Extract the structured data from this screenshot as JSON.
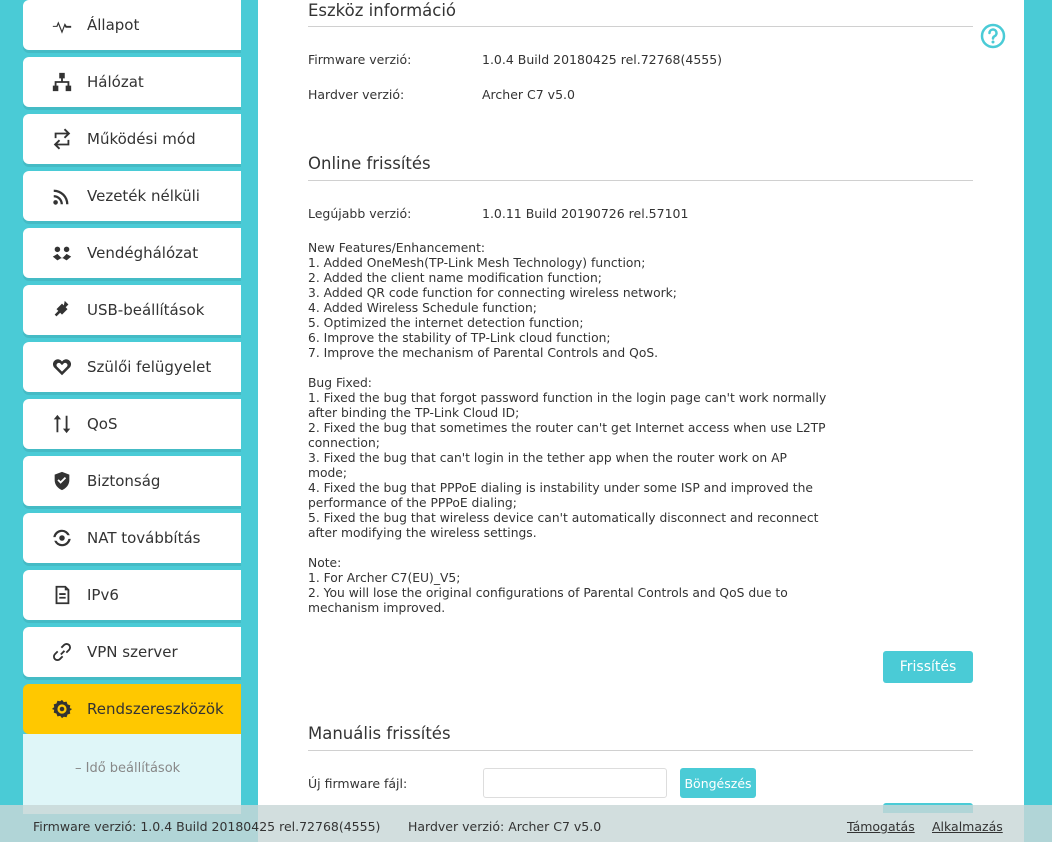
{
  "sidebar": {
    "items": [
      {
        "label": "Állapot",
        "icon": "pulse-icon"
      },
      {
        "label": "Hálózat",
        "icon": "network-icon"
      },
      {
        "label": "Működési mód",
        "icon": "mode-switch-icon"
      },
      {
        "label": "Vezeték nélküli",
        "icon": "wireless-icon"
      },
      {
        "label": "Vendéghálózat",
        "icon": "guest-icon"
      },
      {
        "label": "USB-beállítások",
        "icon": "usb-icon"
      },
      {
        "label": "Szülői felügyelet",
        "icon": "heart-icon"
      },
      {
        "label": "QoS",
        "icon": "qos-arrows-icon"
      },
      {
        "label": "Biztonság",
        "icon": "shield-icon"
      },
      {
        "label": "NAT továbbítás",
        "icon": "nat-icon"
      },
      {
        "label": "IPv6",
        "icon": "ipv6-icon"
      },
      {
        "label": "VPN szerver",
        "icon": "link-icon"
      },
      {
        "label": "Rendszereszközök",
        "icon": "gear-icon",
        "active": true
      }
    ],
    "submenu": {
      "label": "– Idő beállítások"
    }
  },
  "device_info": {
    "title": "Eszköz információ",
    "firmware_label": "Firmware verzió:",
    "firmware_value": "1.0.4 Build 20180425 rel.72768(4555)",
    "hardware_label": "Hardver verzió:",
    "hardware_value": "Archer C7 v5.0"
  },
  "online_update": {
    "title": "Online frissítés",
    "latest_label": "Legújabb verzió:",
    "latest_value": "1.0.11 Build 20190726 rel.57101",
    "notes": "New Features/Enhancement:\n1. Added OneMesh(TP-Link Mesh Technology) function;\n2. Added the client name modification function;\n3. Added QR code function for connecting wireless network;\n4. Added Wireless Schedule function;\n5. Optimized the internet detection function;\n6. Improve the stability of TP-Link cloud function;\n7. Improve the mechanism of Parental Controls and QoS.\n\nBug Fixed:\n1. Fixed the bug that forgot password function in the login page can't work normally after binding the TP-Link Cloud ID;\n2. Fixed the bug that sometimes the router can't get Internet access when use L2TP connection;\n3. Fixed the bug that can't login in the tether app when the router work on AP mode;\n4. Fixed the bug that PPPoE dialing is instability under some ISP and improved the performance of the PPPoE dialing;\n5. Fixed the bug that wireless device can't automatically disconnect and reconnect after modifying the wireless settings.\n\nNote:\n1. For Archer C7(EU)_V5;\n2. You will lose the original configurations of Parental Controls and QoS due to mechanism improved.",
    "update_button": "Frissítés"
  },
  "manual_update": {
    "title": "Manuális frissítés",
    "file_label": "Új firmware fájl:",
    "file_value": "",
    "browse_button": "Böngészés"
  },
  "footer": {
    "firmware": "Firmware verzió: 1.0.4 Build 20180425 rel.72768(4555)",
    "hardware": "Hardver verzió: Archer C7 v5.0",
    "support_link": "Támogatás",
    "app_link": "Alkalmazás"
  },
  "colors": {
    "accent": "#4acbd6",
    "active": "#ffc800"
  }
}
